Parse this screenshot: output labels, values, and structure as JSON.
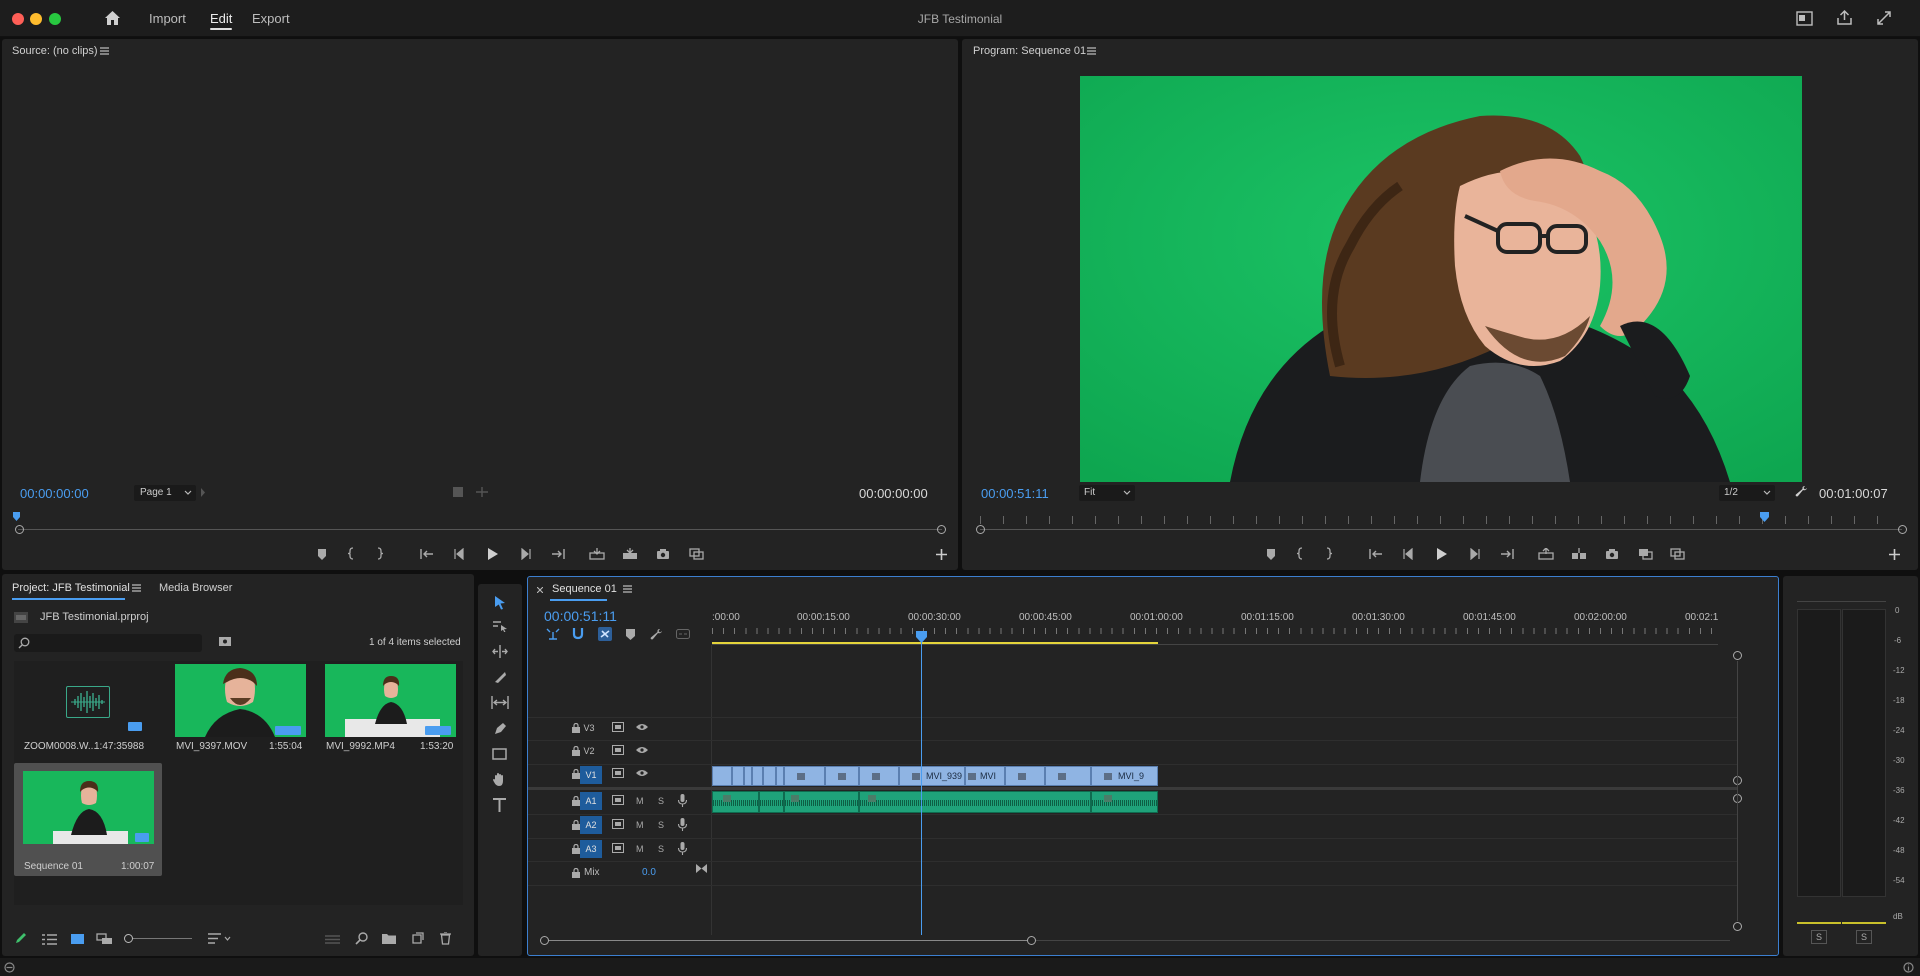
{
  "app": {
    "title": "JFB Testimonial",
    "menu": [
      "Import",
      "Edit",
      "Export"
    ],
    "active_menu": "Edit"
  },
  "source": {
    "title": "Source: (no clips)",
    "timecode_in": "00:00:00:00",
    "timecode_out": "00:00:00:00",
    "page_select": "Page 1"
  },
  "program": {
    "title": "Program: Sequence 01",
    "timecode_in": "00:00:51:11",
    "timecode_out": "00:01:00:07",
    "fit_select": "Fit",
    "resolution_select": "1/2"
  },
  "project": {
    "tab_project": "Project: JFB Testimonial",
    "tab_media": "Media Browser",
    "file": "JFB Testimonial.prproj",
    "selection": "1 of 4 items selected",
    "search_placeholder": "",
    "items": [
      {
        "name": "ZOOM0008.W...",
        "duration": "1:47:35988",
        "kind": "audio"
      },
      {
        "name": "MVI_9397.MOV",
        "duration": "1:55:04",
        "kind": "video"
      },
      {
        "name": "MVI_9992.MP4",
        "duration": "1:53:20",
        "kind": "video"
      },
      {
        "name": "Sequence 01",
        "duration": "1:00:07",
        "kind": "sequence",
        "selected": true
      }
    ]
  },
  "timeline": {
    "tab": "Sequence 01",
    "timecode": "00:00:51:11",
    "ruler": [
      ":00:00",
      "00:00:15:00",
      "00:00:30:00",
      "00:00:45:00",
      "00:01:00:00",
      "00:01:15:00",
      "00:01:30:00",
      "00:01:45:00",
      "00:02:00:00",
      "00:02:1"
    ],
    "video_tracks": [
      "V3",
      "V2",
      "V1"
    ],
    "audio_tracks": [
      "A1",
      "A2",
      "A3"
    ],
    "audio_controls": {
      "mute": "M",
      "solo": "S"
    },
    "mix_label": "Mix",
    "mix_value": "0.0",
    "clip_labels": [
      "MVI_939",
      "MVI",
      "MVI_9"
    ]
  },
  "meter": {
    "scale": [
      "0",
      "-6",
      "-12",
      "-18",
      "-24",
      "-30",
      "-36",
      "-42",
      "-48",
      "-54",
      "dB"
    ],
    "solo": [
      "S",
      "S"
    ]
  },
  "colors": {
    "accent": "#4a9df0",
    "greenscreen": "#16b85a",
    "video_clip": "#8fb4e3",
    "audio_clip": "#1fa27a",
    "track_target": "#1e5c9c"
  }
}
